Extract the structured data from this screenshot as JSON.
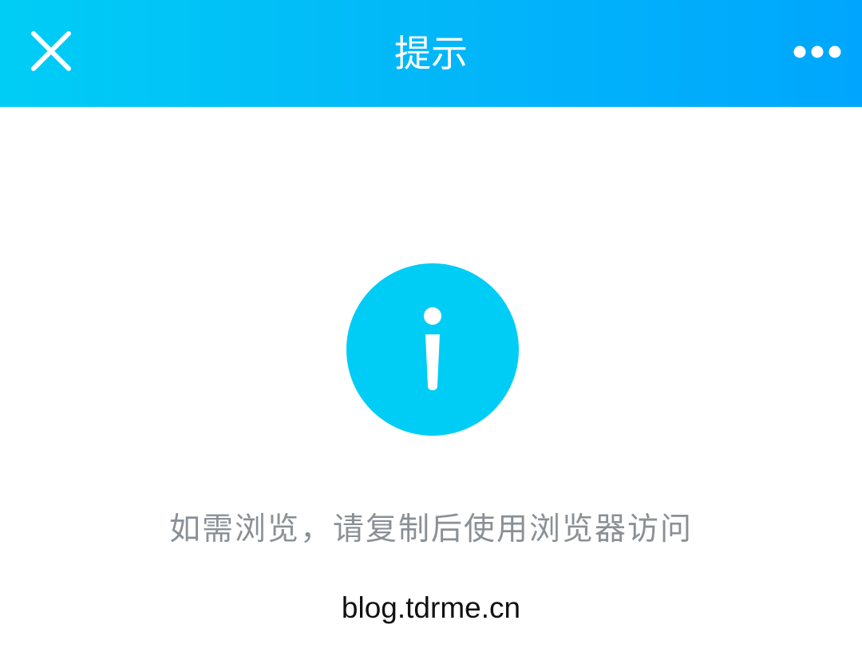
{
  "header": {
    "title": "提示",
    "close_icon": "close-icon",
    "more_icon": "more-horizontal-icon",
    "gradient_start": "#00cdf6",
    "gradient_end": "#00a6fd"
  },
  "main": {
    "icon": "info-icon",
    "icon_color": "#00cdf5",
    "message": "如需浏览，请复制后使用浏览器访问",
    "url": "blog.tdrme.cn"
  }
}
